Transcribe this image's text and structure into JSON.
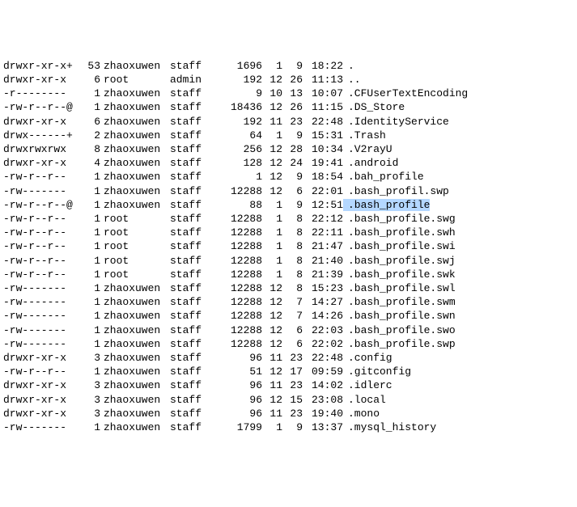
{
  "rows": [
    {
      "perms": "drwxr-xr-x+",
      "links": "53",
      "owner": "zhaoxuwen",
      "group": "staff",
      "size": "1696",
      "mon": "1",
      "day": "9",
      "time": "18:22",
      "name": ".",
      "hl": false
    },
    {
      "perms": "drwxr-xr-x",
      "links": "6",
      "owner": "root",
      "group": "admin",
      "size": "192",
      "mon": "12",
      "day": "26",
      "time": "11:13",
      "name": "..",
      "hl": false
    },
    {
      "perms": "-r--------",
      "links": "1",
      "owner": "zhaoxuwen",
      "group": "staff",
      "size": "9",
      "mon": "10",
      "day": "13",
      "time": "10:07",
      "name": ".CFUserTextEncoding",
      "hl": false
    },
    {
      "perms": "-rw-r--r--@",
      "links": "1",
      "owner": "zhaoxuwen",
      "group": "staff",
      "size": "18436",
      "mon": "12",
      "day": "26",
      "time": "11:15",
      "name": ".DS_Store",
      "hl": false
    },
    {
      "perms": "drwxr-xr-x",
      "links": "6",
      "owner": "zhaoxuwen",
      "group": "staff",
      "size": "192",
      "mon": "11",
      "day": "23",
      "time": "22:48",
      "name": ".IdentityService",
      "hl": false
    },
    {
      "perms": "drwx------+",
      "links": "2",
      "owner": "zhaoxuwen",
      "group": "staff",
      "size": "64",
      "mon": "1",
      "day": "9",
      "time": "15:31",
      "name": ".Trash",
      "hl": false
    },
    {
      "perms": "drwxrwxrwx",
      "links": "8",
      "owner": "zhaoxuwen",
      "group": "staff",
      "size": "256",
      "mon": "12",
      "day": "28",
      "time": "10:34",
      "name": ".V2rayU",
      "hl": false
    },
    {
      "perms": "drwxr-xr-x",
      "links": "4",
      "owner": "zhaoxuwen",
      "group": "staff",
      "size": "128",
      "mon": "12",
      "day": "24",
      "time": "19:41",
      "name": ".android",
      "hl": false
    },
    {
      "perms": "-rw-r--r--",
      "links": "1",
      "owner": "zhaoxuwen",
      "group": "staff",
      "size": "1",
      "mon": "12",
      "day": "9",
      "time": "18:54",
      "name": ".bah_profile",
      "hl": false
    },
    {
      "perms": "-rw-------",
      "links": "1",
      "owner": "zhaoxuwen",
      "group": "staff",
      "size": "12288",
      "mon": "12",
      "day": "6",
      "time": "22:01",
      "name": ".bash_profil.swp",
      "hl": false
    },
    {
      "perms": "-rw-r--r--@",
      "links": "1",
      "owner": "zhaoxuwen",
      "group": "staff",
      "size": "88",
      "mon": "1",
      "day": "9",
      "time": "12:51",
      "name": ".bash_profile",
      "hl": true
    },
    {
      "perms": "-rw-r--r--",
      "links": "1",
      "owner": "root",
      "group": "staff",
      "size": "12288",
      "mon": "1",
      "day": "8",
      "time": "22:12",
      "name": ".bash_profile.swg",
      "hl": false
    },
    {
      "perms": "-rw-r--r--",
      "links": "1",
      "owner": "root",
      "group": "staff",
      "size": "12288",
      "mon": "1",
      "day": "8",
      "time": "22:11",
      "name": ".bash_profile.swh",
      "hl": false
    },
    {
      "perms": "-rw-r--r--",
      "links": "1",
      "owner": "root",
      "group": "staff",
      "size": "12288",
      "mon": "1",
      "day": "8",
      "time": "21:47",
      "name": ".bash_profile.swi",
      "hl": false
    },
    {
      "perms": "-rw-r--r--",
      "links": "1",
      "owner": "root",
      "group": "staff",
      "size": "12288",
      "mon": "1",
      "day": "8",
      "time": "21:40",
      "name": ".bash_profile.swj",
      "hl": false
    },
    {
      "perms": "-rw-r--r--",
      "links": "1",
      "owner": "root",
      "group": "staff",
      "size": "12288",
      "mon": "1",
      "day": "8",
      "time": "21:39",
      "name": ".bash_profile.swk",
      "hl": false
    },
    {
      "perms": "-rw-------",
      "links": "1",
      "owner": "zhaoxuwen",
      "group": "staff",
      "size": "12288",
      "mon": "12",
      "day": "8",
      "time": "15:23",
      "name": ".bash_profile.swl",
      "hl": false
    },
    {
      "perms": "-rw-------",
      "links": "1",
      "owner": "zhaoxuwen",
      "group": "staff",
      "size": "12288",
      "mon": "12",
      "day": "7",
      "time": "14:27",
      "name": ".bash_profile.swm",
      "hl": false
    },
    {
      "perms": "-rw-------",
      "links": "1",
      "owner": "zhaoxuwen",
      "group": "staff",
      "size": "12288",
      "mon": "12",
      "day": "7",
      "time": "14:26",
      "name": ".bash_profile.swn",
      "hl": false
    },
    {
      "perms": "-rw-------",
      "links": "1",
      "owner": "zhaoxuwen",
      "group": "staff",
      "size": "12288",
      "mon": "12",
      "day": "6",
      "time": "22:03",
      "name": ".bash_profile.swo",
      "hl": false
    },
    {
      "perms": "-rw-------",
      "links": "1",
      "owner": "zhaoxuwen",
      "group": "staff",
      "size": "12288",
      "mon": "12",
      "day": "6",
      "time": "22:02",
      "name": ".bash_profile.swp",
      "hl": false
    },
    {
      "perms": "drwxr-xr-x",
      "links": "3",
      "owner": "zhaoxuwen",
      "group": "staff",
      "size": "96",
      "mon": "11",
      "day": "23",
      "time": "22:48",
      "name": ".config",
      "hl": false
    },
    {
      "perms": "-rw-r--r--",
      "links": "1",
      "owner": "zhaoxuwen",
      "group": "staff",
      "size": "51",
      "mon": "12",
      "day": "17",
      "time": "09:59",
      "name": ".gitconfig",
      "hl": false
    },
    {
      "perms": "drwxr-xr-x",
      "links": "3",
      "owner": "zhaoxuwen",
      "group": "staff",
      "size": "96",
      "mon": "11",
      "day": "23",
      "time": "14:02",
      "name": ".idlerc",
      "hl": false
    },
    {
      "perms": "drwxr-xr-x",
      "links": "3",
      "owner": "zhaoxuwen",
      "group": "staff",
      "size": "96",
      "mon": "12",
      "day": "15",
      "time": "23:08",
      "name": ".local",
      "hl": false
    },
    {
      "perms": "drwxr-xr-x",
      "links": "3",
      "owner": "zhaoxuwen",
      "group": "staff",
      "size": "96",
      "mon": "11",
      "day": "23",
      "time": "19:40",
      "name": ".mono",
      "hl": false
    },
    {
      "perms": "-rw-------",
      "links": "1",
      "owner": "zhaoxuwen",
      "group": "staff",
      "size": "1799",
      "mon": "1",
      "day": "9",
      "time": "13:37",
      "name": ".mysql_history",
      "hl": false
    }
  ]
}
